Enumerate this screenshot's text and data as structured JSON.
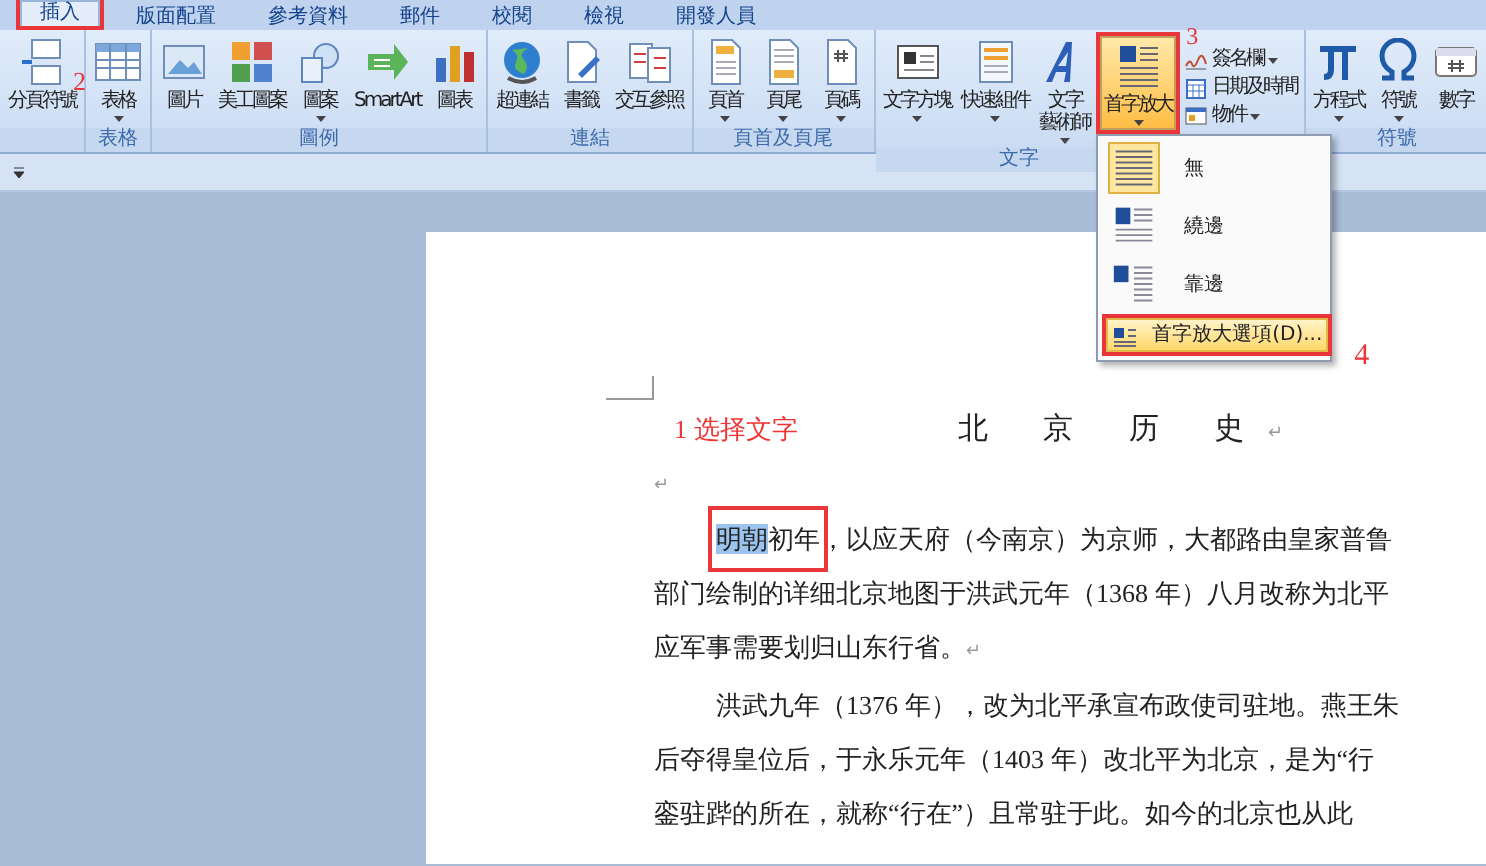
{
  "tabs": [
    {
      "label": "插入",
      "selected": true,
      "annotated": true
    },
    {
      "label": "版面配置",
      "selected": false,
      "annotated": false
    },
    {
      "label": "參考資料",
      "selected": false,
      "annotated": false
    },
    {
      "label": "郵件",
      "selected": false,
      "annotated": false
    },
    {
      "label": "校閱",
      "selected": false,
      "annotated": false
    },
    {
      "label": "檢視",
      "selected": false,
      "annotated": false
    },
    {
      "label": "開發人員",
      "selected": false,
      "annotated": false
    }
  ],
  "ribbon": {
    "groups": [
      {
        "buttons": [
          {
            "label": "分頁符號",
            "kind": "large",
            "dropdown": false,
            "callout": "2"
          }
        ]
      },
      {
        "label": "表格",
        "buttons": [
          {
            "label": "表格",
            "kind": "large",
            "dropdown": true
          }
        ]
      },
      {
        "label": "圖例",
        "buttons": [
          {
            "label": "圖片",
            "kind": "large",
            "dropdown": false
          },
          {
            "label": "美工圖案",
            "kind": "large",
            "dropdown": false
          },
          {
            "label": "圖案",
            "kind": "large",
            "dropdown": true
          },
          {
            "label": "SmartArt",
            "kind": "large",
            "dropdown": false
          },
          {
            "label": "圖表",
            "kind": "large",
            "dropdown": false
          }
        ]
      },
      {
        "label": "連結",
        "buttons": [
          {
            "label": "超連結",
            "kind": "large",
            "dropdown": false
          },
          {
            "label": "書籤",
            "kind": "large",
            "dropdown": false
          },
          {
            "label": "交互參照",
            "kind": "large",
            "dropdown": false
          }
        ]
      },
      {
        "label": "頁首及頁尾",
        "buttons": [
          {
            "label": "頁首",
            "kind": "large",
            "dropdown": true
          },
          {
            "label": "頁尾",
            "kind": "large",
            "dropdown": true
          },
          {
            "label": "頁碼",
            "kind": "large",
            "dropdown": true
          }
        ]
      },
      {
        "label": "文字",
        "buttons": [
          {
            "label": "文字方塊",
            "kind": "large",
            "dropdown": true
          },
          {
            "label": "快速組件",
            "kind": "large",
            "dropdown": true
          },
          {
            "label_lines": [
              "文字",
              "藝術師"
            ],
            "kind": "large",
            "dropdown": true
          },
          {
            "label": "首字放大",
            "kind": "large",
            "dropdown": true,
            "open": true,
            "annotated": true,
            "callout": "3"
          },
          {
            "label": "簽名欄",
            "kind": "small",
            "dropdown": true
          },
          {
            "label": "日期及時間",
            "kind": "small",
            "dropdown": false
          },
          {
            "label": "物件",
            "kind": "small",
            "dropdown": true
          }
        ]
      },
      {
        "label": "符號",
        "buttons": [
          {
            "label": "方程式",
            "kind": "large",
            "dropdown": true
          },
          {
            "label": "符號",
            "kind": "large",
            "dropdown": true
          },
          {
            "label": "數字",
            "kind": "large",
            "dropdown": false
          }
        ]
      }
    ]
  },
  "dropdown_menu": {
    "items": [
      {
        "label": "無",
        "kind": "option",
        "selected": true,
        "hovered": false
      },
      {
        "label": "繞邊",
        "kind": "option",
        "selected": false,
        "hovered": false
      },
      {
        "label": "靠邊",
        "kind": "option",
        "selected": false,
        "hovered": false
      },
      {
        "label": "首字放大選項(D)...",
        "kind": "command",
        "hovered": true,
        "annotated": true,
        "callout": "4"
      }
    ]
  },
  "document": {
    "annotation": "1 选择文字",
    "title": "北 京 历 史",
    "title_mark": "↵",
    "lines": [
      {
        "indent": false,
        "segments": [
          {
            "text": "↵",
            "kind": "mark"
          }
        ]
      },
      {
        "indent": true,
        "segments": [
          {
            "text": "明朝",
            "kind": "text",
            "selected": true,
            "framed": true
          },
          {
            "text": "初年",
            "kind": "text",
            "selected": false,
            "framed": true
          },
          {
            "text": "，以应天府（今南京）为京师，大都路由皇家普鲁",
            "kind": "text",
            "selected": false,
            "framed": false
          }
        ]
      },
      {
        "indent": false,
        "segments": [
          {
            "text": "部门绘制的详细北京地图于洪武元年（1368 年）八月改称为北平",
            "kind": "text"
          }
        ]
      },
      {
        "indent": false,
        "segments": [
          {
            "text": "应军事需要划归山东行省。",
            "kind": "text"
          },
          {
            "text": "↵",
            "kind": "mark"
          }
        ]
      },
      {
        "indent": true,
        "segments": [
          {
            "text": "洪武九年（1376 年），改为北平承宣布政使司驻地。燕王朱",
            "kind": "text"
          }
        ]
      },
      {
        "indent": false,
        "segments": [
          {
            "text": "后夺得皇位后，于永乐元年（1403 年）改北平为北京，是为“行",
            "kind": "text"
          }
        ]
      },
      {
        "indent": false,
        "segments": [
          {
            "text": "銮驻跸的所在，就称“行在”）且常驻于此。如今的北京也从此",
            "kind": "text"
          }
        ]
      }
    ]
  }
}
